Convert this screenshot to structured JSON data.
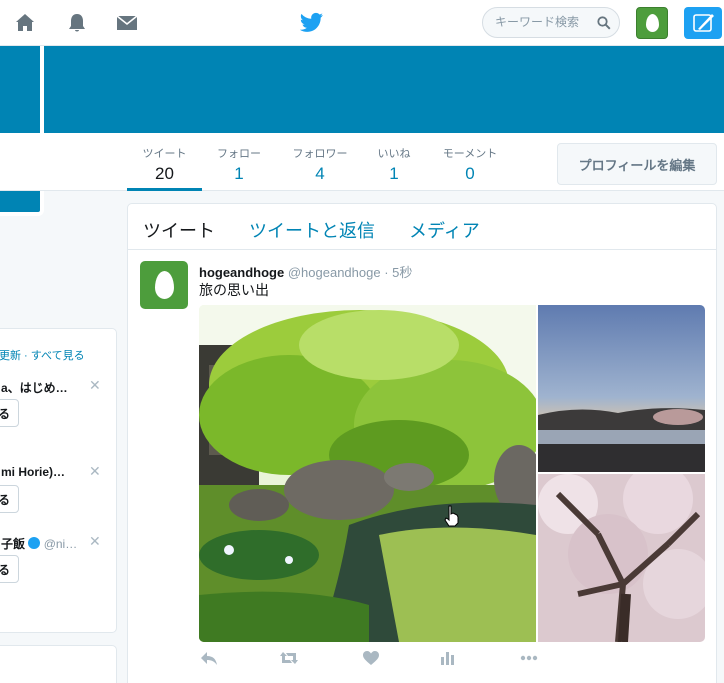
{
  "topbar": {
    "nav": [
      {
        "name": "home-icon"
      },
      {
        "name": "bell-icon"
      },
      {
        "name": "envelope-icon"
      }
    ],
    "search_placeholder": "キーワード検索",
    "brand_color": "#1da1f2"
  },
  "profile_nav": {
    "stats": [
      {
        "label": "ツイート",
        "value": "20"
      },
      {
        "label": "フォロー",
        "value": "1"
      },
      {
        "label": "フォロワー",
        "value": "4"
      },
      {
        "label": "いいね",
        "value": "1"
      },
      {
        "label": "モーメント",
        "value": "0"
      }
    ],
    "edit_profile_label": "プロフィールを編集"
  },
  "who_to_follow": {
    "links": "更新 · すべて見る",
    "items": [
      {
        "name": "a、はじめ…",
        "follow_label": "る"
      },
      {
        "name": "mi Horie)…",
        "follow_label": "る"
      },
      {
        "name": "子飯",
        "handle": "@ni…",
        "follow_label": "る"
      }
    ]
  },
  "timeline": {
    "tabs": [
      "ツイート",
      "ツイートと返信",
      "メディア"
    ],
    "tweet": {
      "name": "hogeandhoge",
      "handle": "@hogeandhoge",
      "separator": "·",
      "time": "5秒",
      "text": "旅の思い出"
    },
    "actions": [
      "reply-icon",
      "retweet-icon",
      "like-icon",
      "analytics-icon",
      "more-icon"
    ]
  },
  "colors": {
    "header_blue": "#0084b4",
    "link_blue": "#0084b4",
    "avatar_green": "#4d9d3c"
  }
}
